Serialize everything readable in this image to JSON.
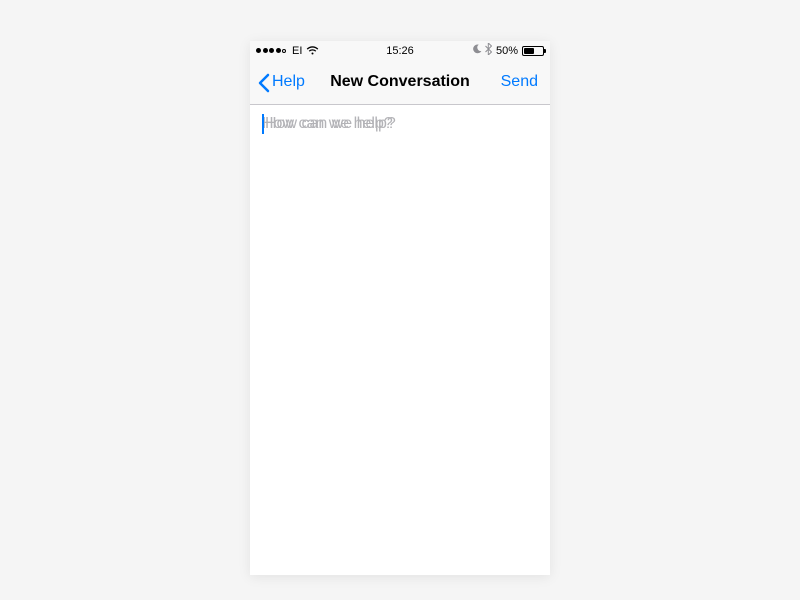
{
  "status_bar": {
    "carrier": "EI",
    "time": "15:26",
    "battery_pct": "50%"
  },
  "nav": {
    "back_label": "Help",
    "title": "New Conversation",
    "send_label": "Send"
  },
  "compose": {
    "placeholder": "How can we help?",
    "value": ""
  }
}
